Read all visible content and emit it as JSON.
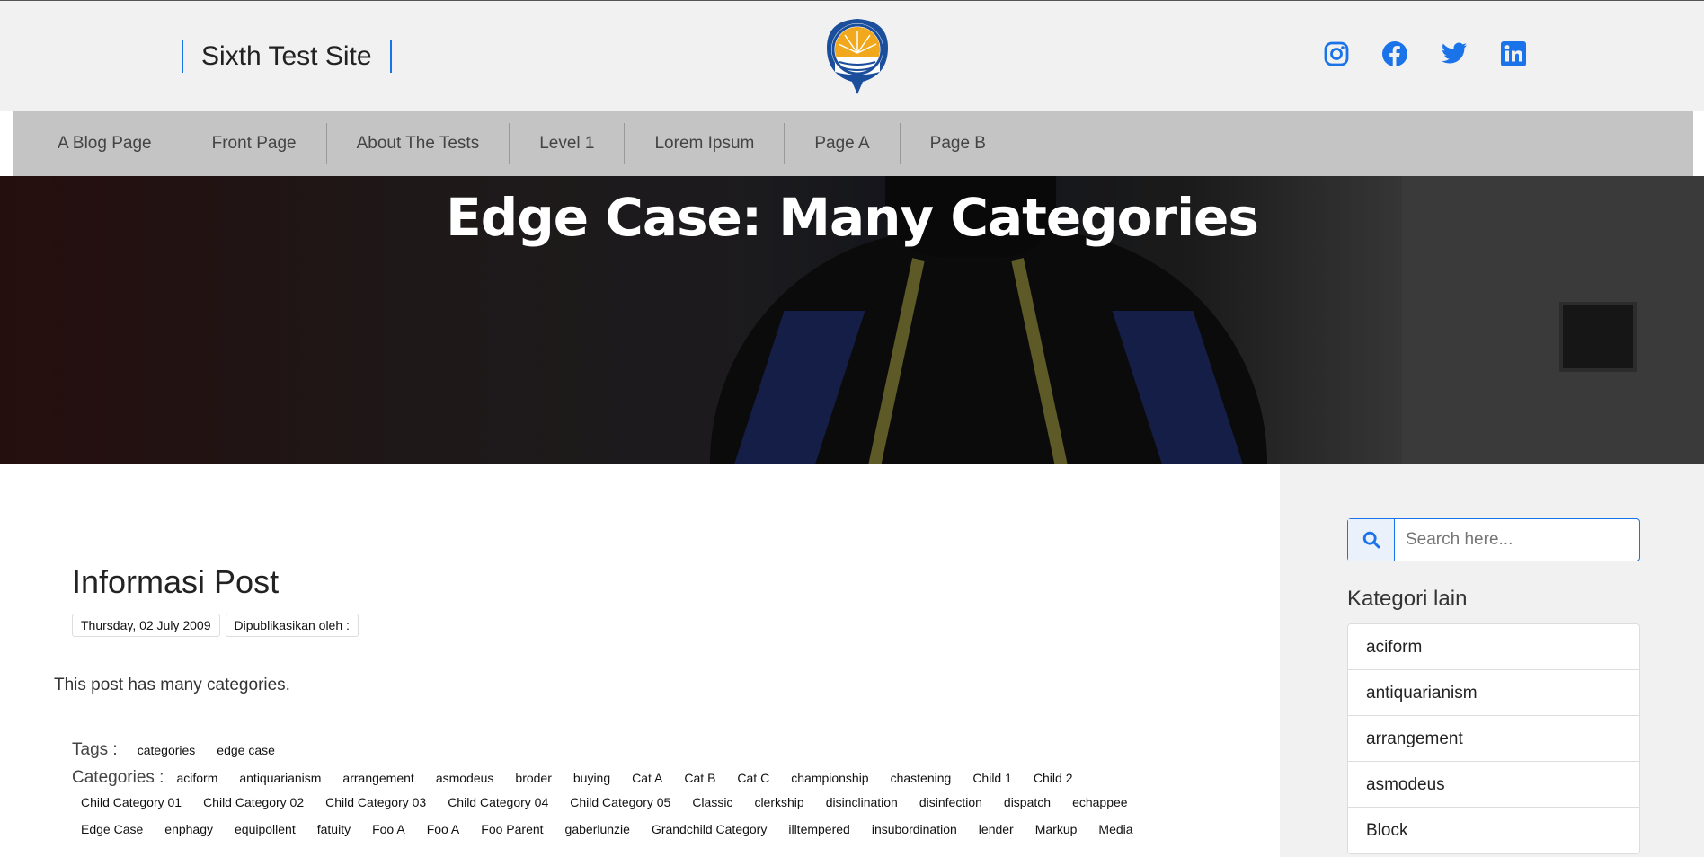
{
  "header": {
    "site_title": "Sixth Test Site",
    "logo_icon": "university-logo-icon",
    "social": [
      {
        "name": "instagram-icon",
        "color": "#1a73e8"
      },
      {
        "name": "facebook-icon",
        "color": "#1a73e8"
      },
      {
        "name": "twitter-icon",
        "color": "#1a73e8"
      },
      {
        "name": "linkedin-icon",
        "color": "#1a73e8"
      }
    ]
  },
  "nav": {
    "items": [
      "A Blog Page",
      "Front Page",
      "About The Tests",
      "Level 1",
      "Lorem Ipsum",
      "Page A",
      "Page B"
    ]
  },
  "hero": {
    "title": "Edge Case: Many Categories"
  },
  "post": {
    "section_title": "Informasi Post",
    "date": "Thursday, 02 July 2009",
    "published_by": "Dipublikasikan oleh :",
    "body": "This post has many categories.",
    "tags_label": "Tags :",
    "tags": [
      "categories",
      "edge case"
    ],
    "categories_label": "Categories :",
    "categories_rows": [
      [
        "aciform",
        "antiquarianism",
        "arrangement",
        "asmodeus",
        "broder",
        "buying",
        "Cat A",
        "Cat B",
        "Cat C",
        "championship",
        "chastening",
        "Child 1",
        "Child 2"
      ],
      [
        "Child Category 01",
        "Child Category 02",
        "Child Category 03",
        "Child Category 04",
        "Child Category 05",
        "Classic",
        "clerkship",
        "disinclination",
        "disinfection",
        "dispatch",
        "echappee"
      ],
      [
        "Edge Case",
        "enphagy",
        "equipollent",
        "fatuity",
        "Foo A",
        "Foo A",
        "Foo Parent",
        "gaberlunzie",
        "Grandchild Category",
        "illtempered",
        "insubordination",
        "lender",
        "Markup",
        "Media"
      ]
    ]
  },
  "sidebar": {
    "search_placeholder": "Search here...",
    "categories_title": "Kategori lain",
    "categories": [
      "aciform",
      "antiquarianism",
      "arrangement",
      "asmodeus",
      "Block"
    ]
  },
  "colors": {
    "accent": "#1a73e8",
    "header_bg": "#f1f1f1",
    "nav_bg": "#c4c4c4"
  }
}
